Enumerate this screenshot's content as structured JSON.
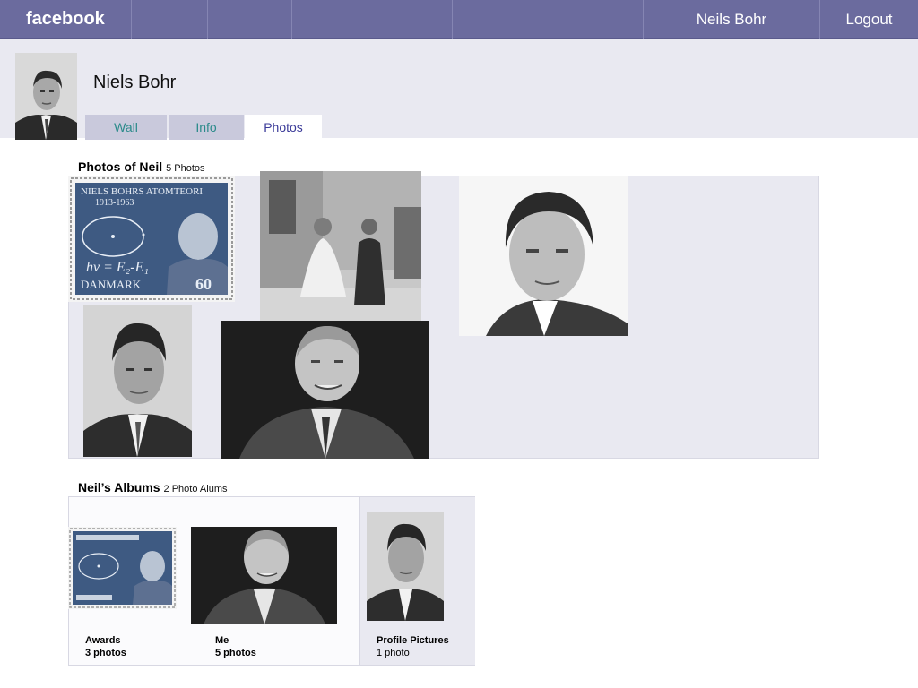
{
  "topbar": {
    "logo": "facebook",
    "user_name": "Neils Bohr",
    "logout": "Logout"
  },
  "profile": {
    "name": "Niels Bohr"
  },
  "tabs": [
    {
      "label": "Wall",
      "active": false
    },
    {
      "label": "Info",
      "active": false
    },
    {
      "label": "Photos",
      "active": true
    }
  ],
  "photos_section": {
    "title": "Photos of Neil",
    "count": "5 Photos"
  },
  "albums_section": {
    "title": "Neil’s  Albums",
    "count": "2 Photo Alums"
  },
  "albums": [
    {
      "name": "Awards",
      "count": "3 photos"
    },
    {
      "name": "Me",
      "count": "5 photos"
    },
    {
      "name": "Profile Pictures",
      "count": "1 photo"
    }
  ],
  "stamp": {
    "heading": "NIELS BOHRS ATOMTEORI",
    "years": "1913-1963",
    "formula": "hν = E₂-E₁",
    "country": "DANMARK",
    "value": "60"
  },
  "colors": {
    "topbar": "#6b6b9e",
    "band": "#e9e9f1",
    "tab_inactive": "#c9c9dc",
    "link": "#2a8a8a"
  }
}
